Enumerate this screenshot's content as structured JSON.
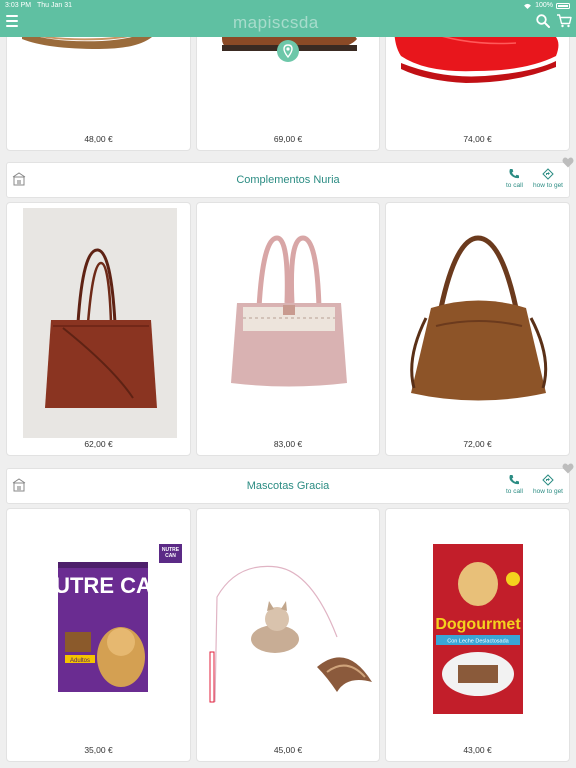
{
  "status_bar": {
    "time": "3:03 PM",
    "date": "Thu Jan 31",
    "battery": "100%"
  },
  "app_bar": {
    "logo_text": "mapiscsda"
  },
  "top_row": {
    "prices": [
      "48,00 €",
      "69,00 €",
      "74,00 €"
    ]
  },
  "stores": [
    {
      "name": "Complementos Nuria",
      "call_label": "to call",
      "directions_label": "how to get",
      "prices": [
        "62,00 €",
        "83,00 €",
        "72,00 €"
      ]
    },
    {
      "name": "Mascotas Gracia",
      "call_label": "to call",
      "directions_label": "how to get",
      "prices": [
        "35,00 €",
        "45,00 €",
        "43,00 €"
      ]
    }
  ],
  "product_text": {
    "nutrecan_badge": "NUTRE CAN",
    "nutrecan_brand": "NUTRE CAN",
    "nutrecan_variant": "Adultos",
    "dogourmet_brand": "Dogourmet",
    "dogourmet_variant": "Con Leche Deslactosada"
  },
  "colors": {
    "accent": "#5fc0a2",
    "store_text": "#2b8c83"
  }
}
